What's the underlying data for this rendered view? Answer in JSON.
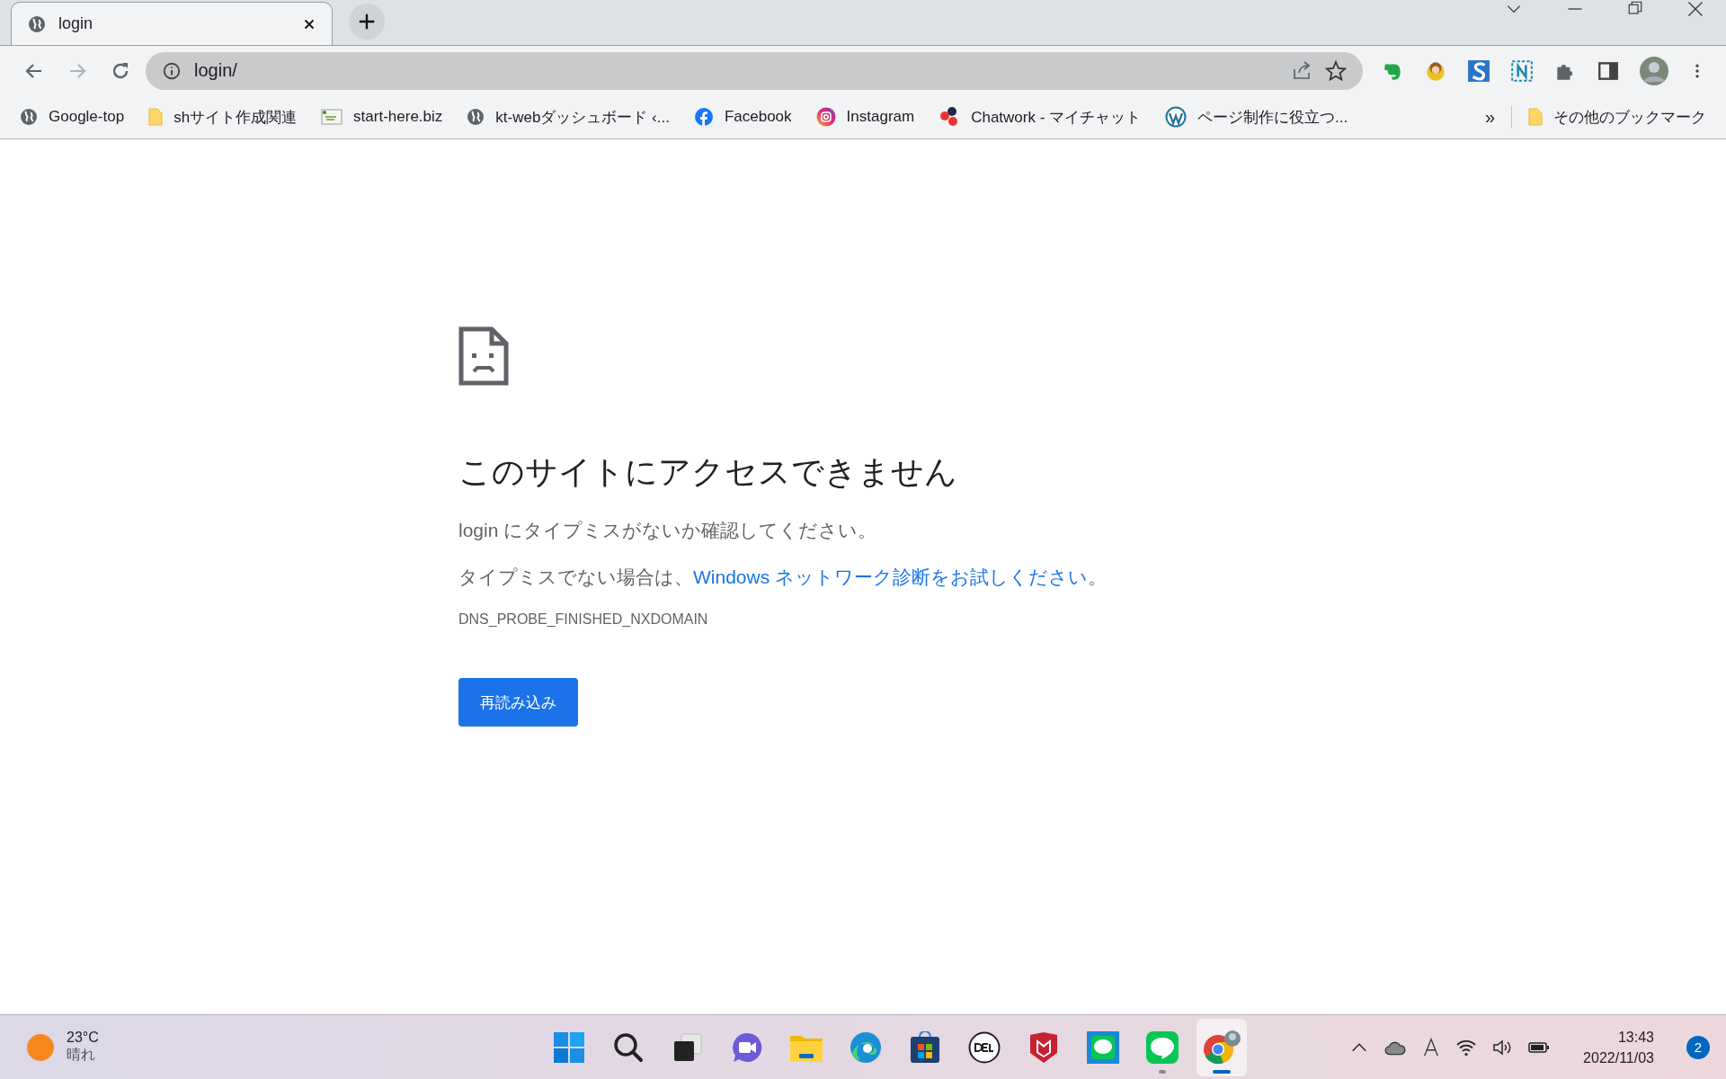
{
  "tabs": [
    {
      "title": "login",
      "selected": true
    }
  ],
  "address_bar": {
    "url": "login/"
  },
  "bookmarks": [
    {
      "label": "Google-top",
      "kind": "globe"
    },
    {
      "label": "shサイト作成関連",
      "kind": "folder"
    },
    {
      "label": "start-here.biz",
      "kind": "thumb"
    },
    {
      "label": "kt-webダッシュボード ‹...",
      "kind": "globe"
    },
    {
      "label": "Facebook",
      "kind": "facebook"
    },
    {
      "label": "Instagram",
      "kind": "instagram"
    },
    {
      "label": "Chatwork - マイチャット",
      "kind": "chatwork"
    },
    {
      "label": "ページ制作に役立つ...",
      "kind": "wordpress"
    }
  ],
  "bookmarks_overflow": "»",
  "other_bookmarks": "その他のブックマーク",
  "error": {
    "heading": "このサイトにアクセスできません",
    "message": "login にタイプミスがないか確認してください。",
    "suggestion_prefix": "タイプミスでない場合は、",
    "suggestion_link": "Windows ネットワーク診断をお試しください",
    "suggestion_suffix": "。",
    "code": "DNS_PROBE_FINISHED_NXDOMAIN",
    "button": "再読み込み"
  },
  "taskbar": {
    "weather": {
      "temperature": "23°C",
      "condition": "晴れ"
    },
    "apps": [
      {
        "kind": "start",
        "running": false,
        "selected": false
      },
      {
        "kind": "search",
        "running": false,
        "selected": false
      },
      {
        "kind": "taskview",
        "running": false,
        "selected": false
      },
      {
        "kind": "chat",
        "running": false,
        "selected": false
      },
      {
        "kind": "folder",
        "running": false,
        "selected": false
      },
      {
        "kind": "edge",
        "running": false,
        "selected": false
      },
      {
        "kind": "store",
        "running": false,
        "selected": false
      },
      {
        "kind": "dell",
        "running": false,
        "selected": false
      },
      {
        "kind": "shield",
        "running": false,
        "selected": false
      },
      {
        "kind": "line-square",
        "running": false,
        "selected": false
      },
      {
        "kind": "line",
        "running": true,
        "selected": false
      },
      {
        "kind": "chrome",
        "running": true,
        "selected": true
      }
    ],
    "time": "13:43",
    "date": "2022/11/03",
    "notifications": "2"
  }
}
